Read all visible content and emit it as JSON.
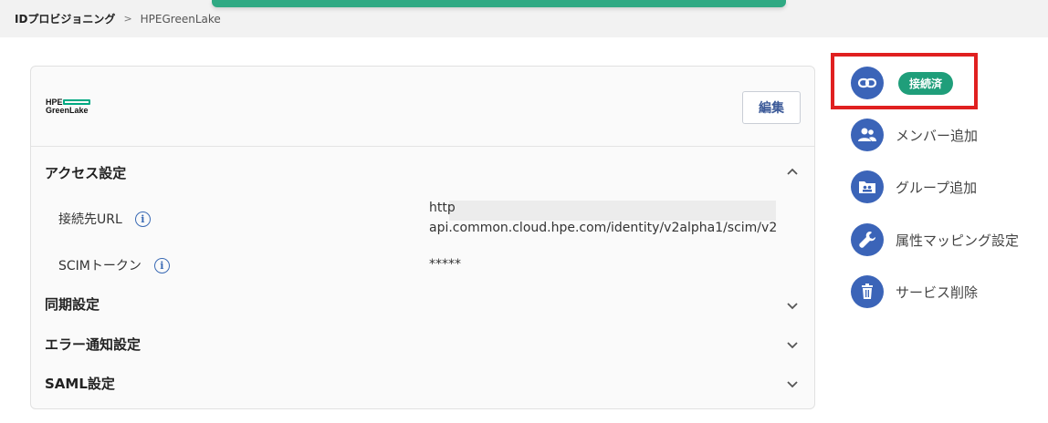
{
  "breadcrumb": {
    "root": "IDプロビジョニング",
    "separator": ">",
    "current": "HPEGreenLake"
  },
  "card": {
    "logo": {
      "line1": "HPE",
      "line2": "GreenLake"
    },
    "edit_label": "編集",
    "sections": {
      "access": {
        "title": "アクセス設定",
        "url_label": "接続先URL",
        "url_value_line1": "http",
        "url_value_line2": "api.common.cloud.hpe.com/identity/v2alpha1/scim/v2",
        "token_label": "SCIMトークン",
        "token_value": "*****"
      },
      "sync": {
        "title": "同期設定"
      },
      "error": {
        "title": "エラー通知設定"
      },
      "saml": {
        "title": "SAML設定"
      }
    }
  },
  "actions": {
    "connection_badge": "接続済",
    "add_member": "メンバー追加",
    "add_group": "グループ追加",
    "attribute_mapping": "属性マッピング設定",
    "delete_service": "サービス削除"
  },
  "colors": {
    "accent_blue": "#3b64b8",
    "badge_green": "#1f9e7a",
    "toast_green": "#2fa983",
    "highlight_red": "#e02020"
  }
}
